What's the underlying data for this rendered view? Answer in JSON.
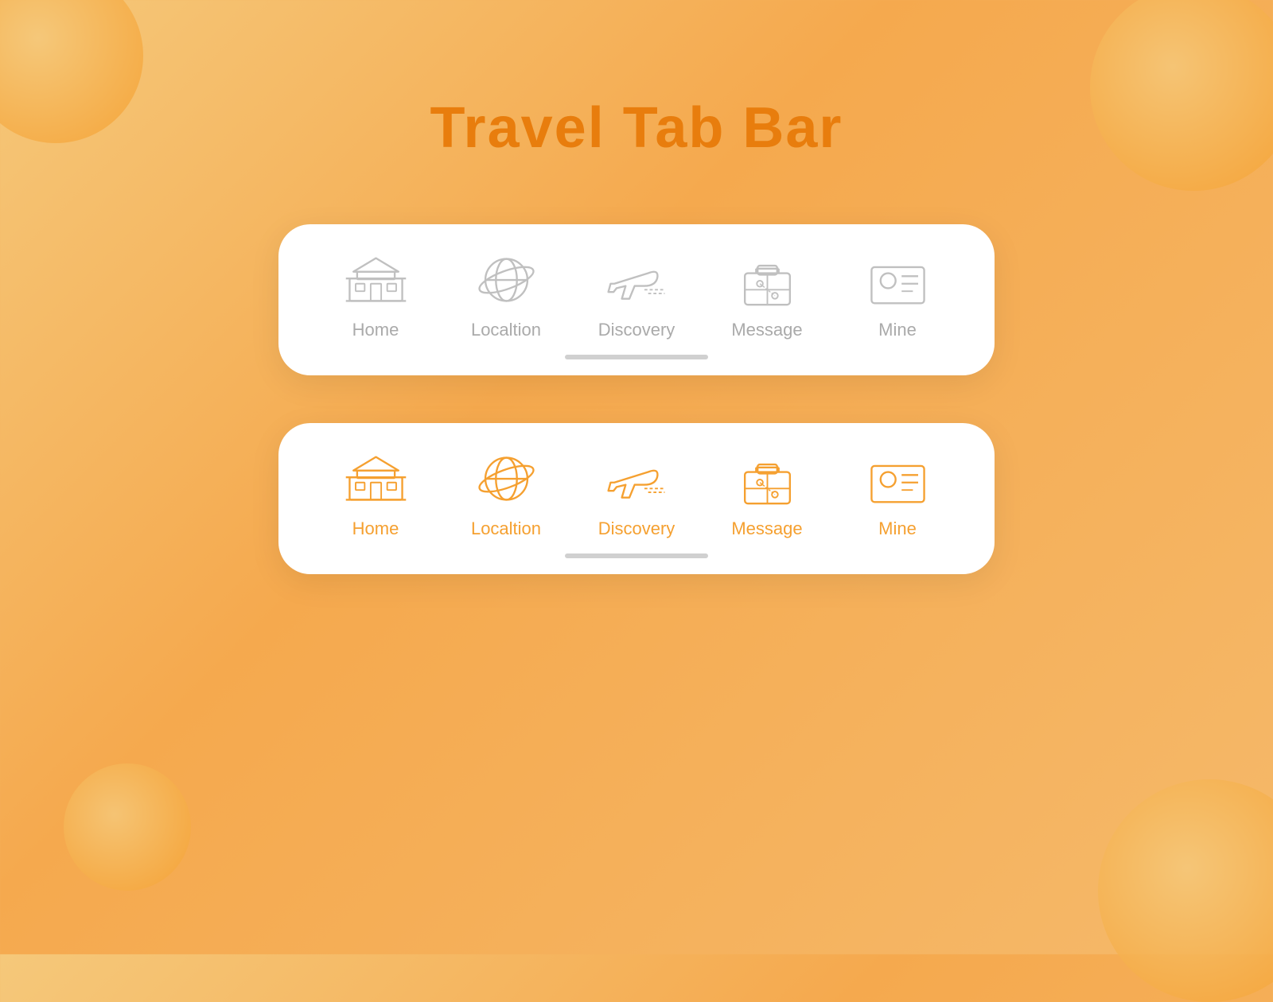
{
  "page": {
    "title": "Travel Tab Bar",
    "title_color": "#e87d0d"
  },
  "tab_bars": [
    {
      "id": "inactive-bar",
      "state": "inactive",
      "items": [
        {
          "id": "home",
          "label": "Home",
          "active": false
        },
        {
          "id": "location",
          "label": "Localtion",
          "active": false
        },
        {
          "id": "discovery",
          "label": "Discovery",
          "active": false
        },
        {
          "id": "message",
          "label": "Message",
          "active": false
        },
        {
          "id": "mine",
          "label": "Mine",
          "active": false
        }
      ]
    },
    {
      "id": "active-bar",
      "state": "active",
      "items": [
        {
          "id": "home",
          "label": "Home",
          "active": true
        },
        {
          "id": "location",
          "label": "Localtion",
          "active": true
        },
        {
          "id": "discovery",
          "label": "Discovery",
          "active": true
        },
        {
          "id": "message",
          "label": "Message",
          "active": true
        },
        {
          "id": "mine",
          "label": "Mine",
          "active": true
        }
      ]
    }
  ]
}
